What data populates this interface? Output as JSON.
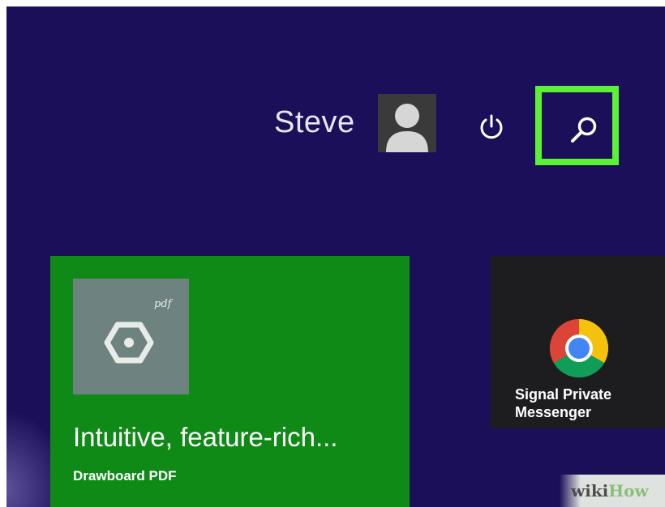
{
  "user": {
    "name": "Steve",
    "avatar_icon": "user-silhouette-icon"
  },
  "header": {
    "power_icon": "power-icon",
    "search_icon": "search-icon",
    "highlight_color": "#5bf233"
  },
  "tiles": [
    {
      "id": "drawboard",
      "title": "Intuitive, feature-rich...",
      "subtitle": "Drawboard PDF",
      "icon": "drawboard-hexagon-icon",
      "icon_mark": "pdf",
      "color": "#0f8a17"
    },
    {
      "id": "signal",
      "label_line1": "Signal Private",
      "label_line2": "Messenger",
      "icon": "chrome-icon",
      "color": "#1d1d1f"
    }
  ],
  "watermark": {
    "prefix": "wiki",
    "suffix": "How"
  },
  "colors": {
    "background": "#1c0f5a"
  }
}
